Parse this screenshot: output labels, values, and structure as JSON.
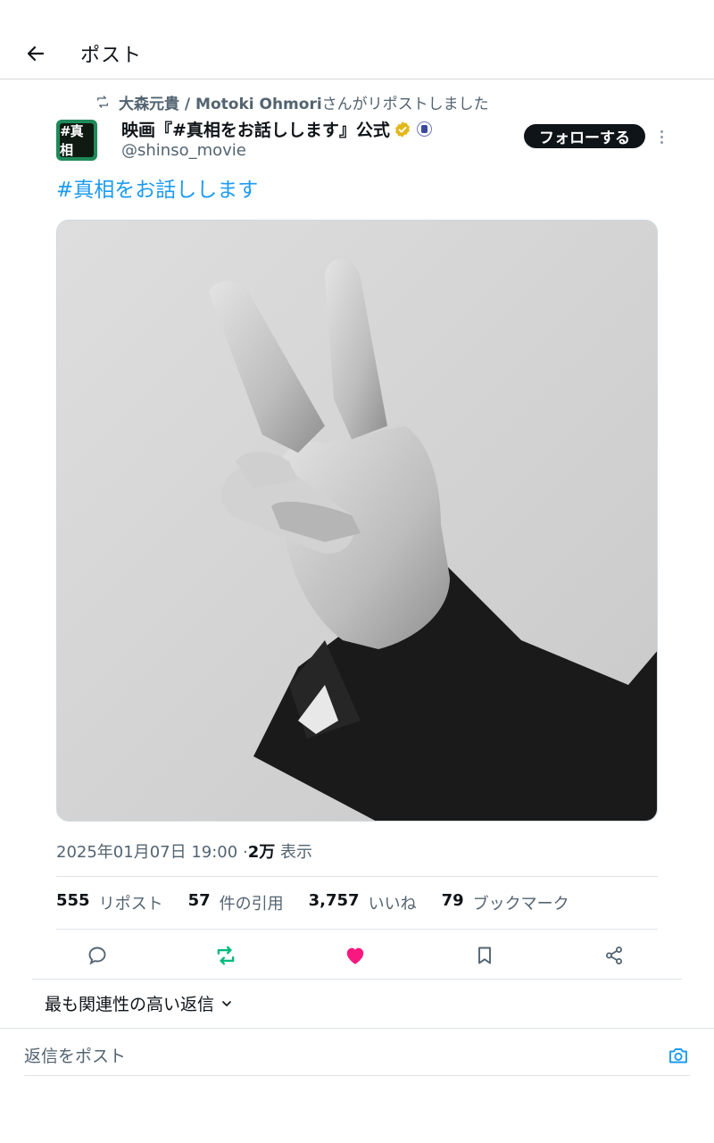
{
  "header": {
    "title": "ポスト",
    "back_icon": "arrow-left-icon"
  },
  "repost": {
    "user": "大森元貴 / Motoki Ohmori",
    "suffix": "さんがリポストしました",
    "icon": "repost-icon"
  },
  "author": {
    "avatar_text": "#真相",
    "name": "映画『#真相をお話しします』公式",
    "handle": "@shinso_movie",
    "verified": true,
    "follow_label": "フォローする"
  },
  "post": {
    "hashtag": "#真相をお話しします",
    "timestamp": "2025年01月07日 19:00",
    "separator": "·",
    "views": "2万",
    "views_label": "表示"
  },
  "stats": [
    {
      "num": "555",
      "label": "リポスト"
    },
    {
      "num": "57",
      "label": "件の引用"
    },
    {
      "num": "3,757",
      "label": "いいね"
    },
    {
      "num": "79",
      "label": "ブックマーク"
    }
  ],
  "colors": {
    "accent": "#1d9bf0",
    "repost_active": "#00ba7c",
    "like_active": "#f91880",
    "verified": "#e2b719"
  },
  "replies": {
    "sort_label": "最も関連性の高い返信",
    "input_placeholder": "返信をポスト"
  }
}
